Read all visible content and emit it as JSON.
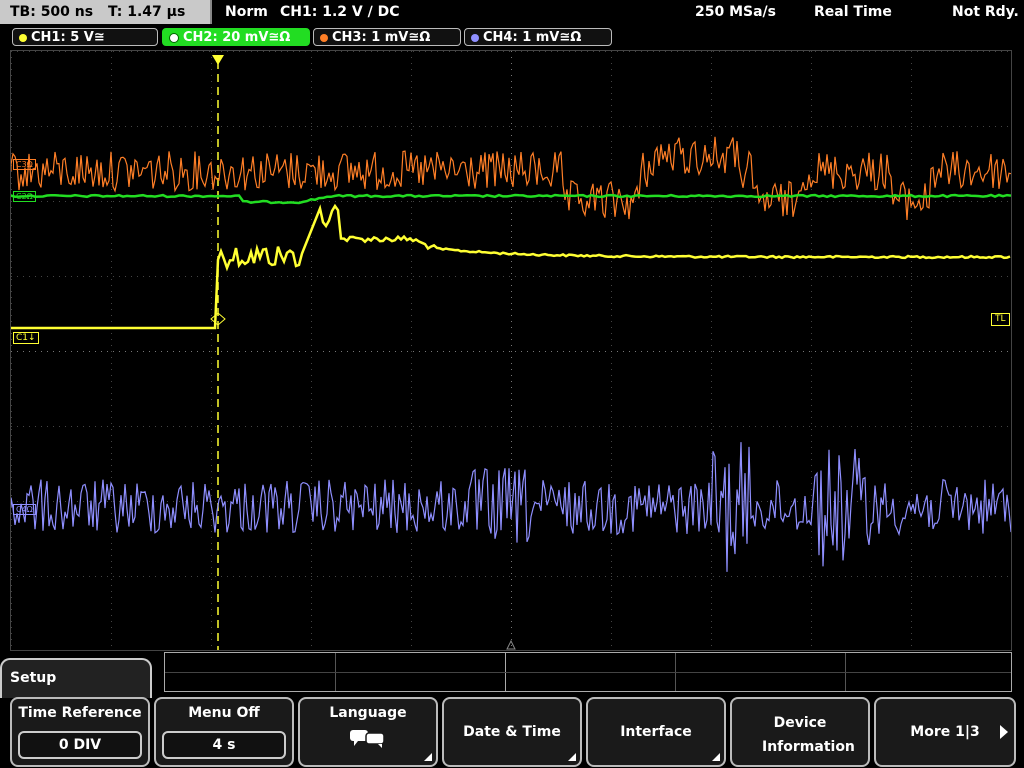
{
  "status": {
    "tb": "TB: 500 ns",
    "t": "T: 1.47 µs",
    "mode": "Norm",
    "trigger": "CH1: 1.2 V ∕ DC",
    "rate": "250 MSa/s",
    "acq": "Real Time",
    "state": "Not Rdy."
  },
  "channels": [
    {
      "label": "CH1: 5 V≅",
      "color": "#ffff33"
    },
    {
      "label": "CH2: 20 mV≅Ω",
      "color": "#22dd22"
    },
    {
      "label": "CH3: 1 mV≅Ω",
      "color": "#ff7f27"
    },
    {
      "label": "CH4: 1 mV≅Ω",
      "color": "#8f8fff"
    }
  ],
  "markers": {
    "c1": "C1↓",
    "tl": "TL",
    "ch2": "C2Ω",
    "ch3": "C3Ω",
    "ch4": "C4Ω"
  },
  "menu": {
    "title": "Setup",
    "softkeys": [
      {
        "label": "Time Reference",
        "value": "0 DIV"
      },
      {
        "label": "Menu Off",
        "value": "4 s"
      },
      {
        "label": "Language",
        "icon": "speech-bubbles-icon"
      },
      {
        "label": "Date & Time"
      },
      {
        "label": "Interface"
      },
      {
        "label": "Device Information"
      },
      {
        "label": "More 1|3"
      }
    ]
  }
}
